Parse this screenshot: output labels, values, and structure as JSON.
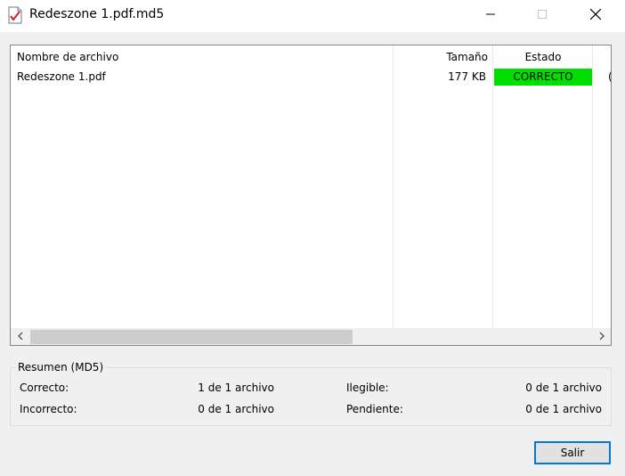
{
  "window": {
    "title": "Redeszone 1.pdf.md5",
    "icon": "checklist-document-icon"
  },
  "list": {
    "columns": {
      "name": "Nombre de archivo",
      "size": "Tamaño",
      "status": "Estado"
    },
    "rows": [
      {
        "name": "Redeszone 1.pdf",
        "size": "177 KB",
        "status": "CORRECTO",
        "status_color": "#00e000",
        "extra": "("
      }
    ]
  },
  "summary": {
    "title": "Resumen (MD5)",
    "correct_label": "Correcto:",
    "correct_value": "1 de 1 archivo",
    "incorrect_label": "Incorrecto:",
    "incorrect_value": "0 de 1 archivo",
    "unreadable_label": "Ilegible:",
    "unreadable_value": "0 de 1 archivo",
    "pending_label": "Pendiente:",
    "pending_value": "0 de 1 archivo"
  },
  "buttons": {
    "exit_label": "Salir"
  },
  "colors": {
    "accent": "#0078d7",
    "status_ok": "#00e000"
  }
}
